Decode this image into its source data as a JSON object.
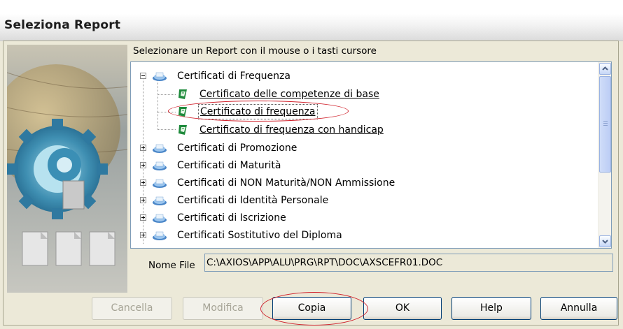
{
  "dialog": {
    "title": "Seleziona Report"
  },
  "instruction": "Selezionare un Report con il mouse o i tasti cursore",
  "tree": {
    "items": [
      {
        "label": "Certificati di Frequenza",
        "type": "folder",
        "expanded": true,
        "children": [
          {
            "label": "Certificato delle competenze di base"
          },
          {
            "label": "Certificato di frequenza",
            "selected": true
          },
          {
            "label": "Certificato di frequenza con handicap"
          }
        ]
      },
      {
        "label": "Certificati di Promozione",
        "type": "folder",
        "expanded": false
      },
      {
        "label": "Certificati di Maturità",
        "type": "folder",
        "expanded": false
      },
      {
        "label": "Certificati di NON Maturità/NON Ammissione",
        "type": "folder",
        "expanded": false
      },
      {
        "label": "Certificati di Identità Personale",
        "type": "folder",
        "expanded": false
      },
      {
        "label": "Certificati di Iscrizione",
        "type": "folder",
        "expanded": false
      },
      {
        "label": "Certificati Sostitutivo del Diploma",
        "type": "folder",
        "expanded": false
      }
    ]
  },
  "filename": {
    "label": "Nome File",
    "value": "C:\\AXIOS\\APP\\ALU\\PRG\\RPT\\DOC\\AXSCEFR01.DOC"
  },
  "buttons": {
    "cancella": "Cancella",
    "modifica": "Modifica",
    "copia": "Copia",
    "ok": "OK",
    "help": "Help",
    "annulla": "Annulla"
  },
  "colors": {
    "annotation_red": "#d0212b",
    "folder_blue": "#4a86c8",
    "doc_green": "#1f8a3c"
  },
  "icons": [
    "folder-icon",
    "report-doc-icon",
    "expand-icon",
    "collapse-icon",
    "scroll-up-icon",
    "scroll-down-icon"
  ]
}
